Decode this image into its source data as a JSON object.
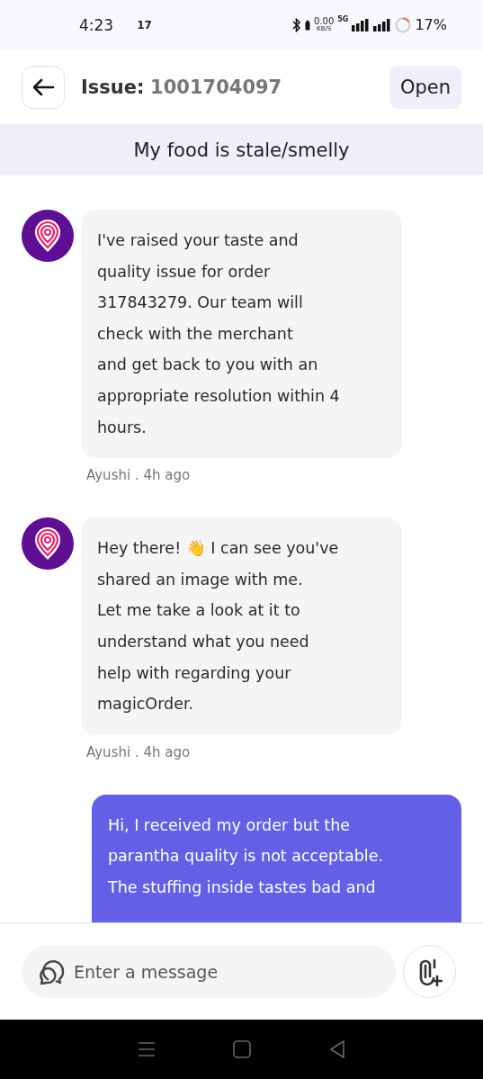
{
  "status_bar": {
    "time": "4:23",
    "notification": "17",
    "network_speed": "0.00",
    "network_unit": "KB/S",
    "network_type": "5G",
    "battery": "17%"
  },
  "header": {
    "label": "Issue:",
    "issue_number": "1001704097",
    "status": "Open"
  },
  "topic": "My food is stale/smelly",
  "messages": [
    {
      "kind": "agent",
      "lines": [
        "I've raised your taste and",
        "quality issue for order",
        "317843279. Our team will",
        "check with the merchant",
        "and get back to you with an",
        "appropriate resolution within 4",
        "hours."
      ],
      "meta": "Ayushi . 4h ago"
    },
    {
      "kind": "agent",
      "lines": [
        "Hey there! 👋 I can see you've",
        "shared an image with me.",
        "Let me take a look at it to",
        "understand what you need",
        "help with regarding your",
        "magicOrder."
      ],
      "meta": "Ayushi . 4h ago"
    },
    {
      "kind": "user",
      "lines": [
        "Hi, I received my order but the",
        "parantha quality is not acceptable.",
        "The stuffing inside tastes bad and"
      ]
    }
  ],
  "composer": {
    "placeholder": "Enter a message"
  }
}
